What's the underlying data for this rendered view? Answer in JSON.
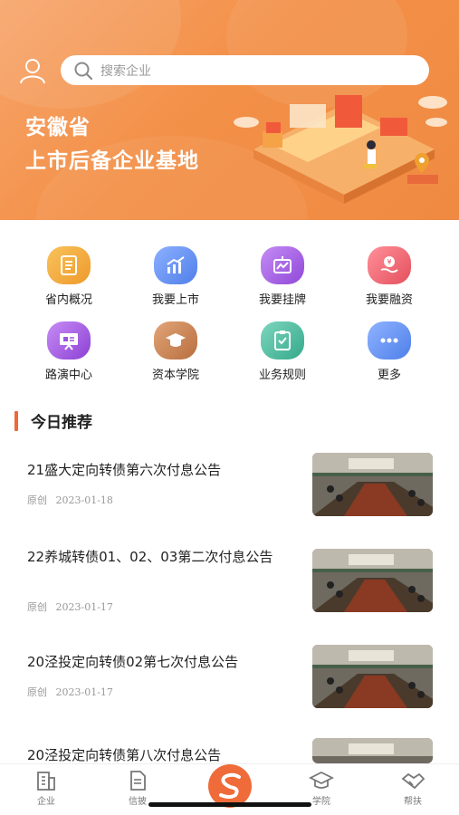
{
  "header": {
    "search_placeholder": "搜索企业",
    "banner_line1": "安徽省",
    "banner_line2": "上市后备企业基地"
  },
  "grid": [
    {
      "label": "省内概况",
      "icon": "document-list-icon",
      "color": "#f2a93b"
    },
    {
      "label": "我要上市",
      "icon": "chart-trend-icon",
      "color": "#5b8ef0"
    },
    {
      "label": "我要挂牌",
      "icon": "board-chart-icon",
      "color": "#a45be0"
    },
    {
      "label": "我要融资",
      "icon": "finance-hand-icon",
      "color": "#ee5f6a"
    },
    {
      "label": "路演中心",
      "icon": "presentation-icon",
      "color": "#9c54dd"
    },
    {
      "label": "资本学院",
      "icon": "graduation-cap-icon",
      "color": "#c9804f"
    },
    {
      "label": "业务规则",
      "icon": "checklist-icon",
      "color": "#3fb79a"
    },
    {
      "label": "更多",
      "icon": "more-dots-icon",
      "color": "#5d8ef1"
    }
  ],
  "section": {
    "title": "今日推荐"
  },
  "articles": [
    {
      "title": "21盛大定向转债第六次付息公告",
      "tag": "原创",
      "date": "2023-01-18"
    },
    {
      "title": "22养城转债01、02、03第二次付息公告",
      "tag": "原创",
      "date": "2023-01-17"
    },
    {
      "title": "20泾投定向转债02第七次付息公告",
      "tag": "原创",
      "date": "2023-01-17"
    },
    {
      "title": "20泾投定向转债第八次付息公告",
      "tag": "",
      "date": ""
    }
  ],
  "tabbar": [
    {
      "label": "企业",
      "icon": "building-icon"
    },
    {
      "label": "信披",
      "icon": "document-icon"
    },
    {
      "label": "",
      "icon": "logo-icon"
    },
    {
      "label": "学院",
      "icon": "graduation-cap-icon"
    },
    {
      "label": "帮扶",
      "icon": "handshake-icon"
    }
  ]
}
